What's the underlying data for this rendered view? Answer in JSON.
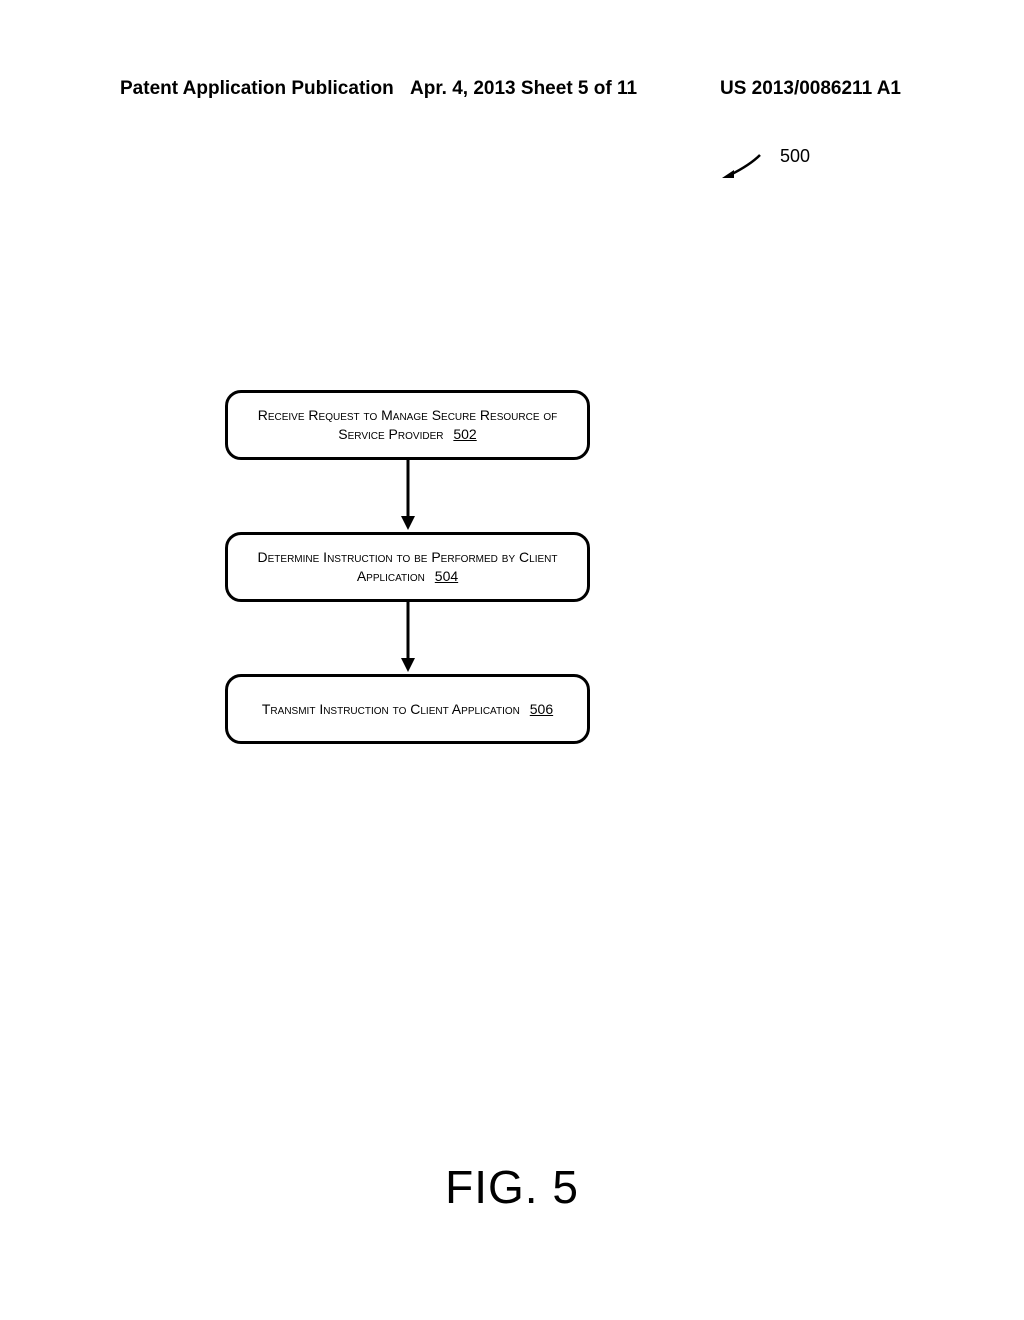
{
  "header": {
    "left": "Patent Application Publication",
    "center": "Apr. 4, 2013  Sheet 5 of 11",
    "right": "US 2013/0086211 A1"
  },
  "reference": {
    "label": "500"
  },
  "chart_data": {
    "type": "flowchart",
    "title": "FIG. 5",
    "nodes": [
      {
        "id": "502",
        "text": "Receive Request to Manage Secure Resource of Service Provider",
        "ref": "502"
      },
      {
        "id": "504",
        "text": "Determine Instruction to be Performed by Client Application",
        "ref": "504"
      },
      {
        "id": "506",
        "text": "Transmit Instruction to Client Application",
        "ref": "506"
      }
    ],
    "edges": [
      {
        "from": "502",
        "to": "504"
      },
      {
        "from": "504",
        "to": "506"
      }
    ]
  },
  "figure": {
    "label": "FIG. 5"
  }
}
